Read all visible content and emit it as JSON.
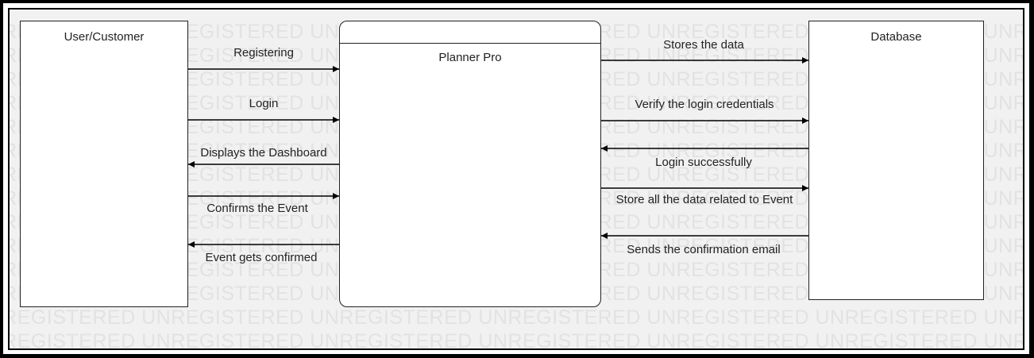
{
  "diagram": {
    "watermark_text": "UNREGISTERED",
    "entities": {
      "user": "User/Customer",
      "process": "Planner Pro",
      "database": "Database"
    },
    "flows_left": {
      "registering": "Registering",
      "login": "Login",
      "displays_dashboard": "Displays the Dashboard",
      "confirms_event": "Confirms the Event",
      "event_confirmed": "Event gets confirmed"
    },
    "flows_right": {
      "stores_data": "Stores the data",
      "verify_login": "Verify the login credentials",
      "login_success": "Login successfully",
      "store_event_data": "Store all the data related to Event",
      "send_email": "Sends the confirmation email"
    }
  }
}
